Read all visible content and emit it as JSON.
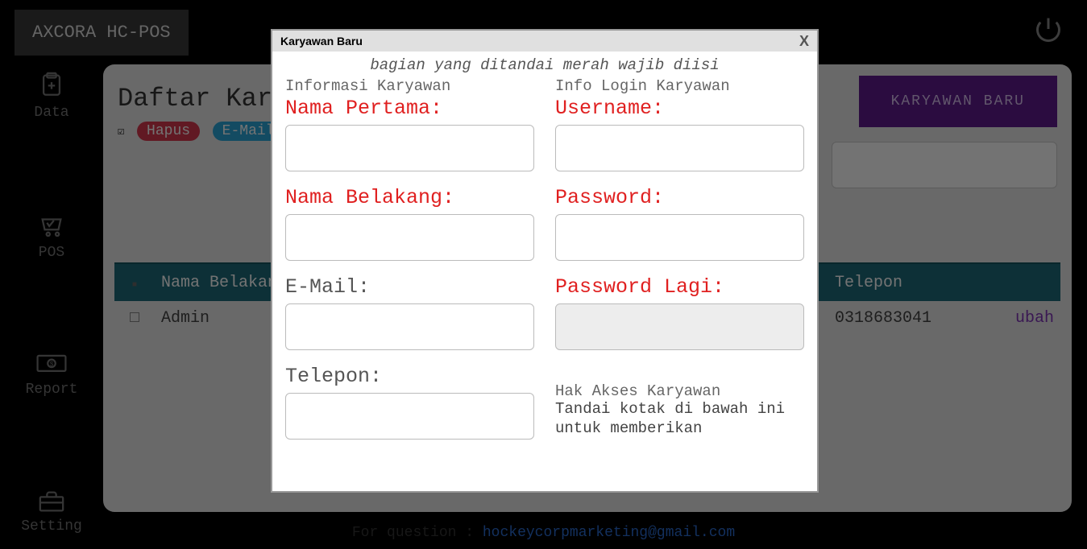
{
  "app": {
    "logo": "AXCORA HC-POS"
  },
  "sidebar": {
    "items": [
      {
        "label": "Data"
      },
      {
        "label": "POS"
      },
      {
        "label": "Report"
      },
      {
        "label": "Setting"
      }
    ]
  },
  "page": {
    "title": "Daftar Karyawan",
    "badge_hapus": "Hapus",
    "badge_email": "E-Mail",
    "new_btn": "KARYAWAN BARU"
  },
  "table": {
    "col_name": "Nama Belakang",
    "col_tel": "Telepon",
    "rows": [
      {
        "name": "Admin",
        "tel": "0318683041",
        "edit": "ubah"
      }
    ]
  },
  "footer": {
    "q": "For question : ",
    "email": "hockeycorpmarketing@gmail.com"
  },
  "modal": {
    "title": "Karyawan Baru",
    "close": "X",
    "hint": "bagian yang ditandai merah wajib diisi",
    "left_head": "Informasi Karyawan",
    "right_head": "Info Login Karyawan",
    "f_first": "Nama Pertama:",
    "f_last": "Nama Belakang:",
    "f_email": "E-Mail:",
    "f_phone": "Telepon:",
    "f_user": "Username:",
    "f_pass": "Password:",
    "f_pass2": "Password Lagi:",
    "access_head": "Hak Akses Karyawan",
    "access_note": "Tandai kotak di bawah ini untuk memberikan"
  }
}
